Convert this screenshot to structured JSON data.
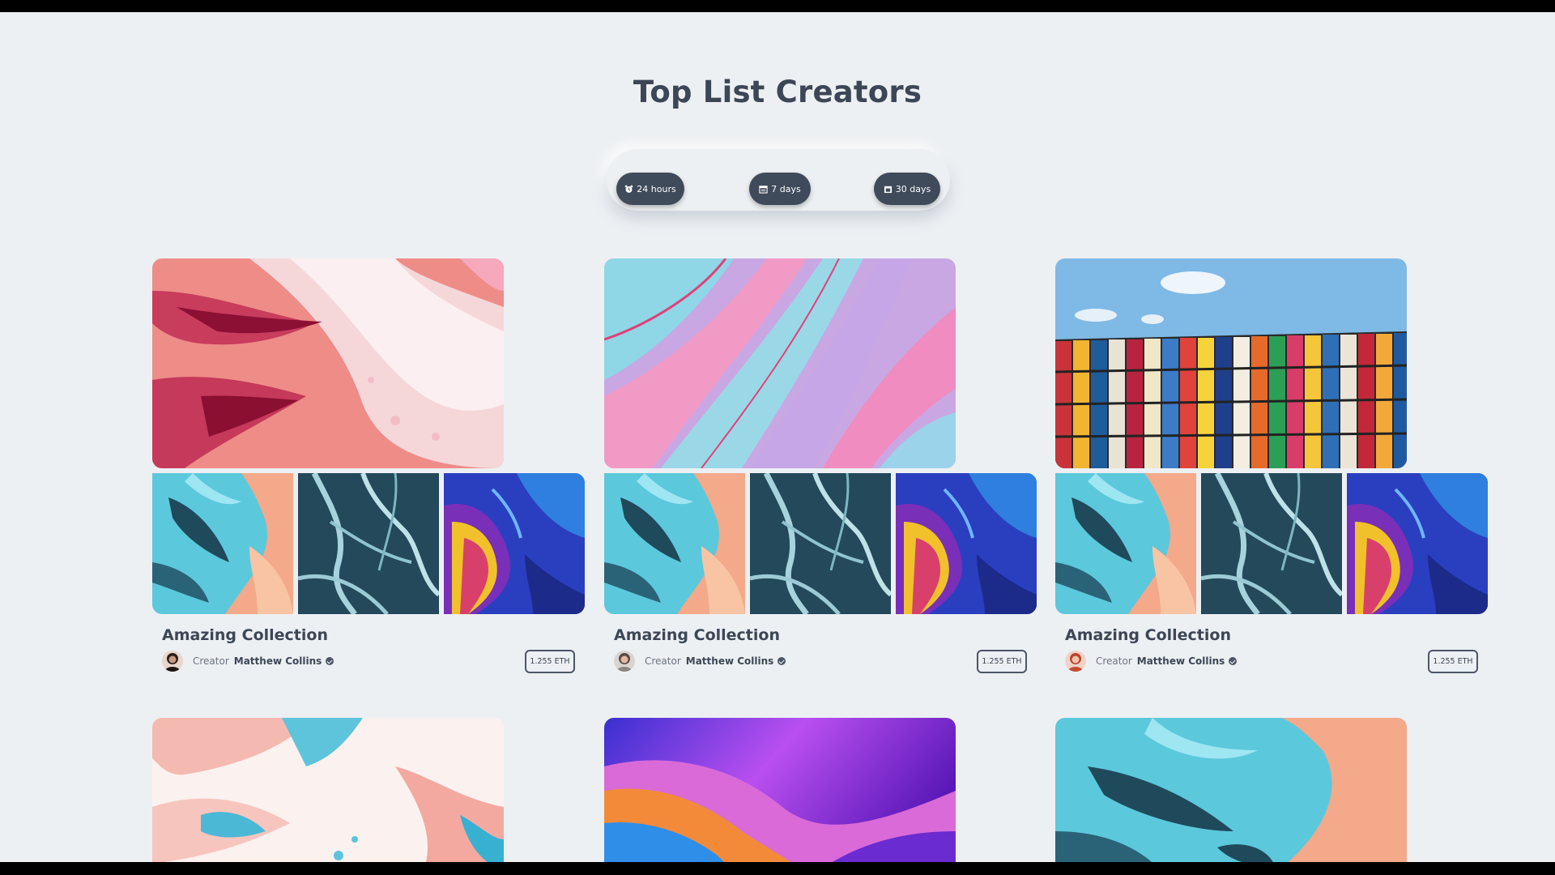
{
  "page": {
    "title": "Top List Creators"
  },
  "filters": [
    {
      "label": "24 hours",
      "icon": "alarm-clock-icon"
    },
    {
      "label": "7 days",
      "icon": "calendar-icon"
    },
    {
      "label": "30 days",
      "icon": "calendar-icon"
    }
  ],
  "collections": [
    {
      "title": "Amazing Collection",
      "creator_label": "Creator",
      "creator_name": "Matthew Collins",
      "price": "1.255 ETH",
      "hero": "pink-fluid-art",
      "thumbs": [
        "aerial-ice-teal-orange",
        "aerial-river-dark",
        "purple-yellow-fluid"
      ]
    },
    {
      "title": "Amazing Collection",
      "creator_label": "Creator",
      "creator_name": "Matthew Collins",
      "price": "1.255 ETH",
      "hero": "pastel-marble-swirl",
      "thumbs": [
        "aerial-ice-teal-orange",
        "aerial-river-dark",
        "purple-yellow-fluid"
      ]
    },
    {
      "title": "Amazing Collection",
      "creator_label": "Creator",
      "creator_name": "Matthew Collins",
      "price": "1.255 ETH",
      "hero": "colorful-tiles-building",
      "thumbs": [
        "aerial-ice-teal-orange",
        "aerial-river-dark",
        "purple-yellow-fluid"
      ]
    }
  ],
  "next_row": [
    "pink-blue-paint",
    "purple-gradient-waves",
    "aerial-ice-teal-orange"
  ]
}
